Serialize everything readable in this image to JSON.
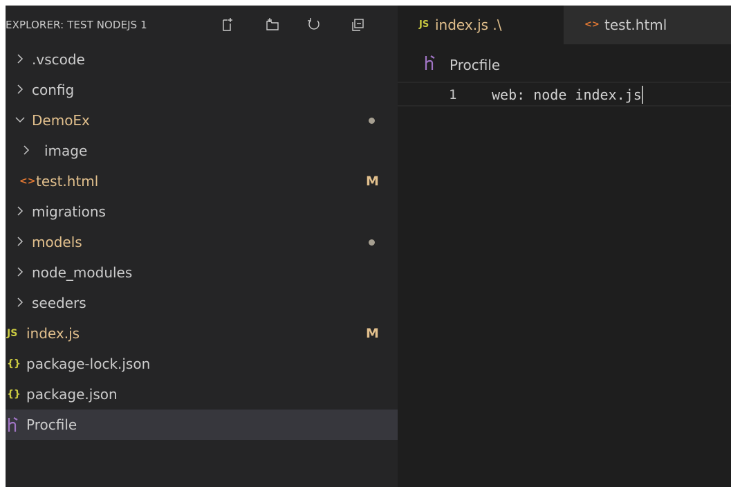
{
  "explorer": {
    "title": "EXPLORER: TEST NODEJS 1",
    "actions": [
      {
        "name": "new-file-icon"
      },
      {
        "name": "new-folder-icon"
      },
      {
        "name": "refresh-icon"
      },
      {
        "name": "collapse-all-icon"
      }
    ],
    "tree": [
      {
        "label": ".vscode",
        "type": "folder",
        "expanded": false,
        "depth": 0
      },
      {
        "label": "config",
        "type": "folder",
        "expanded": false,
        "depth": 0
      },
      {
        "label": "DemoEx",
        "type": "folder",
        "expanded": true,
        "depth": 0,
        "modified": true,
        "decoration": "dot"
      },
      {
        "label": "image",
        "type": "folder",
        "expanded": false,
        "depth": 1
      },
      {
        "label": "test.html",
        "type": "html",
        "depth": 1,
        "modified": true,
        "decoration": "M"
      },
      {
        "label": "migrations",
        "type": "folder",
        "expanded": false,
        "depth": 0
      },
      {
        "label": "models",
        "type": "folder",
        "expanded": false,
        "depth": 0,
        "modified": true,
        "decoration": "dot"
      },
      {
        "label": "node_modules",
        "type": "folder",
        "expanded": false,
        "depth": 0
      },
      {
        "label": "seeders",
        "type": "folder",
        "expanded": false,
        "depth": 0
      },
      {
        "label": "index.js",
        "type": "js",
        "depth": 0,
        "modified": true,
        "decoration": "M"
      },
      {
        "label": "package-lock.json",
        "type": "json",
        "depth": 0
      },
      {
        "label": "package.json",
        "type": "json",
        "depth": 0
      },
      {
        "label": "Procfile",
        "type": "heroku",
        "depth": 0,
        "selected": true
      }
    ]
  },
  "tabs": [
    {
      "icon": "JS",
      "label": "index.js .\\",
      "modified": true
    },
    {
      "icon": "<>",
      "label": "test.html"
    }
  ],
  "breadcrumb": {
    "label": "Procfile"
  },
  "editor": {
    "lines": [
      {
        "number": "1",
        "text": "web: node index.js"
      }
    ]
  },
  "colors": {
    "sidebar_bg": "#252526",
    "editor_bg": "#1e1e1e",
    "selected_row": "#37373d",
    "modified_text": "#e2c08d",
    "js_icon": "#cbcb41",
    "json_icon": "#cbcb41",
    "html_icon": "#e37933",
    "heroku_icon": "#a074c4"
  }
}
